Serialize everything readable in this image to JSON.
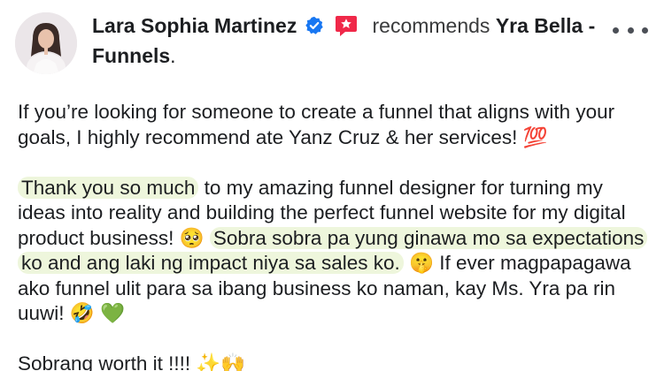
{
  "post": {
    "author": "Lara Sophia Martinez",
    "recommends_word": "recommends",
    "page_name": "Yra Bella - Funnels",
    "page_name_suffix": "."
  },
  "icons": {
    "verified": "verified-badge-icon",
    "recommend": "recommend-star-icon",
    "more": "more-options-icon",
    "accent": "#1877f2",
    "recommend_color": "#f02849"
  },
  "body": {
    "p1": "If you’re looking for someone to create a funnel that aligns with your goals, I highly recommend ate Yanz Cruz & her services! 💯",
    "p2_hl1": "Thank you so much",
    "p2_a": " to my amazing funnel designer for turning my ideas into reality and building the perfect funnel website for my digital product business! 🥺 ",
    "p2_hl2": "Sobra sobra pa yung ginawa mo sa expectations ko and ang laki ng impact niya sa sales ko.",
    "p2_b": " 🤫 If ever magpapagawa ako funnel ulit para sa ibang business ko naman, kay Ms. Yra pa rin uuwi! 🤣 💚",
    "p3": "Sobrang worth it !!!! ✨🙌"
  }
}
